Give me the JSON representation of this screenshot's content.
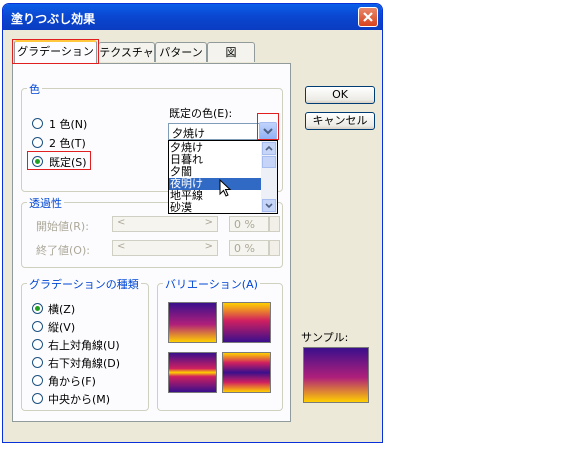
{
  "dialog": {
    "title": "塗りつぶし効果"
  },
  "tabs": [
    "グラデーション",
    "テクスチャ",
    "パターン",
    "図"
  ],
  "buttons": {
    "ok": "OK",
    "cancel": "キャンセル"
  },
  "color_group": {
    "label": "色",
    "options": [
      "1 色(N)",
      "2 色(T)",
      "既定(S)"
    ],
    "selected": "既定(S)",
    "preset_label": "既定の色(E):",
    "preset_value": "夕焼け",
    "preset_items": [
      "夕焼け",
      "日暮れ",
      "夕闇",
      "夜明け",
      "地平線",
      "砂漠"
    ],
    "highlighted_item": "夜明け"
  },
  "transparency": {
    "label": "透過性",
    "start_label": "開始値(R):",
    "end_label": "終了値(O):",
    "start_value": "0 %",
    "end_value": "0 %"
  },
  "gradient_type": {
    "label": "グラデーションの種類",
    "options": [
      "横(Z)",
      "縦(V)",
      "右上対角線(U)",
      "右下対角線(D)",
      "角から(F)",
      "中央から(M)"
    ],
    "selected": "横(Z)"
  },
  "variation": {
    "label": "バリエーション(A)"
  },
  "sample": {
    "label": "サンプル:"
  },
  "colors": {
    "accent": "#0046d5",
    "titlebar": "#0a47d1",
    "highlight_box": "#e02020",
    "selection": "#316ac5",
    "sunset_top": "#3a0f8c",
    "sunset_mid": "#d02060",
    "sunset_bottom": "#ffd000"
  },
  "icons": [
    "close-icon",
    "dropdown-arrow-icon",
    "scroll-up-icon",
    "scroll-down-icon",
    "mouse-cursor-icon",
    "spin-up-icon",
    "spin-down-icon"
  ]
}
